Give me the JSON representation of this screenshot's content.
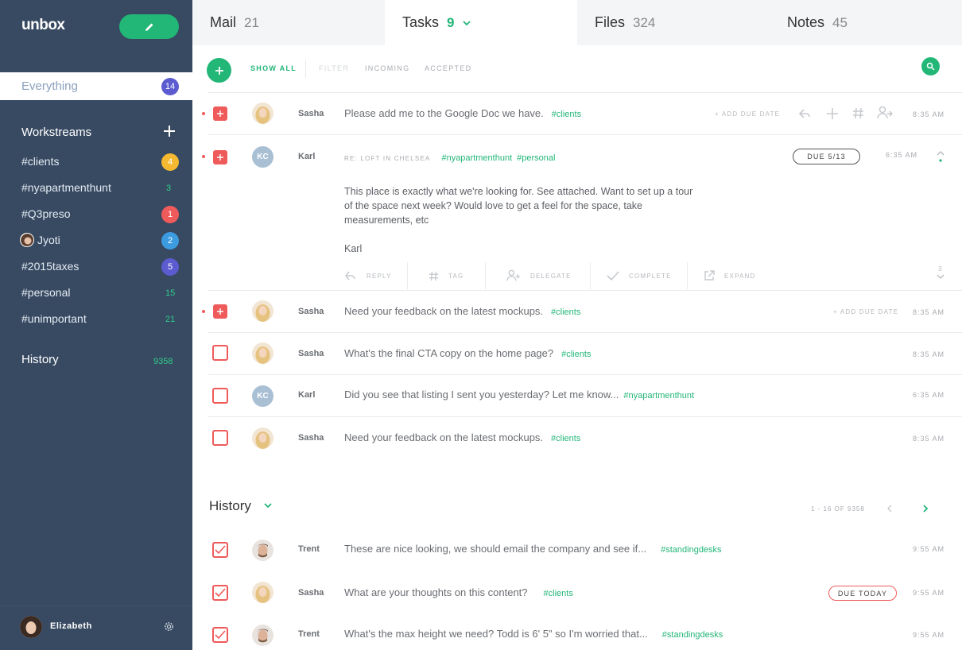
{
  "sidebar": {
    "logo": "unbox",
    "everything": {
      "label": "Everything",
      "count": "14"
    },
    "workstreams_label": "Workstreams",
    "items": [
      {
        "label": "#clients",
        "count": "4",
        "style": "badge",
        "color": "#f5b931"
      },
      {
        "label": "#nyapartmenthunt",
        "count": "3",
        "style": "text"
      },
      {
        "label": "#Q3preso",
        "count": "1",
        "style": "badge",
        "color": "#ef5a5a"
      },
      {
        "label": "Jyoti",
        "count": "2",
        "style": "badge",
        "color": "#3d9be0"
      },
      {
        "label": "#2015taxes",
        "count": "5",
        "style": "badge",
        "color": "#5c5bd0"
      },
      {
        "label": "#personal",
        "count": "15",
        "style": "text"
      },
      {
        "label": "#unimportant",
        "count": "21",
        "style": "text"
      }
    ],
    "history": {
      "label": "History",
      "count": "9358"
    },
    "user": {
      "name": "Elizabeth"
    }
  },
  "tabs": [
    {
      "label": "Mail",
      "count": "21"
    },
    {
      "label": "Tasks",
      "count": "9"
    },
    {
      "label": "Files",
      "count": "324"
    },
    {
      "label": "Notes",
      "count": "45"
    }
  ],
  "toolbar": {
    "show_all": "SHOW ALL",
    "filter": "FILTER",
    "incoming": "INCOMING",
    "accepted": "ACCEPTED"
  },
  "tasks": [
    {
      "sender": "Sasha",
      "subject": "Please add me to the Google Doc we have.",
      "tag": "#clients",
      "time": "8:35 AM",
      "due_action": "+ ADD DUE DATE"
    },
    {
      "sender": "Karl",
      "subject": "RE: LOFT IN CHELSEA",
      "tags": [
        "#nyapartmenthunt",
        "#personal"
      ],
      "time": "6:35 AM",
      "due": "DUE 5/13",
      "body": "This place is exactly what we're looking for. See attached. Want to set up a tour of the space next week? Would love to get a feel for the space, take measurements, etc",
      "signature": "Karl",
      "actions": [
        "REPLY",
        "TAG",
        "DELEGATE",
        "COMPLETE",
        "EXPAND"
      ],
      "thread_count": "3",
      "avatar_initials": "KC"
    },
    {
      "sender": "Sasha",
      "subject": "Need your feedback on the latest mockups.",
      "tag": "#clients",
      "time": "8:35 AM",
      "due_action": "+ ADD DUE DATE"
    },
    {
      "sender": "Sasha",
      "subject": "What's the final CTA copy on the home page?",
      "tag": "#clients",
      "time": "8:35 AM"
    },
    {
      "sender": "Karl",
      "subject": "Did you see that listing I sent you yesterday? Let me know...",
      "tag": "#nyapartmenthunt",
      "time": "6:35 AM",
      "avatar_initials": "KC"
    },
    {
      "sender": "Sasha",
      "subject": "Need your feedback on the latest mockups.",
      "tag": "#clients",
      "time": "8:35 AM"
    }
  ],
  "history": {
    "title": "History",
    "pagination": "1 - 16 OF 9358",
    "items": [
      {
        "sender": "Trent",
        "subject": "These are nice looking, we should email the company and see if...",
        "tag": "#standingdesks",
        "time": "9:55 AM"
      },
      {
        "sender": "Sasha",
        "subject": "What are your thoughts on this content?",
        "tag": "#clients",
        "time": "9:55 AM",
        "due": "DUE TODAY"
      },
      {
        "sender": "Trent",
        "subject": "What's the max height we need? Todd is 6' 5\" so I'm worried that...",
        "tag": "#standingdesks",
        "time": "9:55 AM"
      }
    ]
  },
  "colors": {
    "sidebar": "#384a62",
    "accent": "#22b677",
    "alert": "#ef5a5a"
  }
}
